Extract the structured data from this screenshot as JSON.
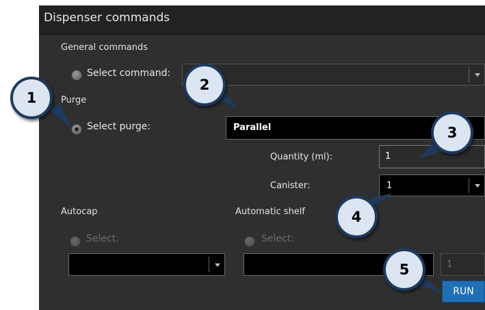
{
  "dialog": {
    "title": "Dispenser commands"
  },
  "general_commands": {
    "section_label": "General commands",
    "radio_label": "Select command:",
    "combo_value": ""
  },
  "purge": {
    "section_label": "Purge",
    "radio_label": "Select purge:",
    "combo_value": "Parallel",
    "quantity_label": "Quantity (ml):",
    "quantity_value": "1",
    "canister_label": "Canister:",
    "canister_value": "1"
  },
  "autocap": {
    "section_label": "Autocap",
    "radio_label": "Select:",
    "combo_value": ""
  },
  "automatic_shelf": {
    "section_label": "Automatic shelf",
    "radio_label": "Select:",
    "combo_value": "",
    "quantity_value": "1"
  },
  "run_button": {
    "label": "RUN"
  },
  "callouts": [
    "1",
    "2",
    "3",
    "4",
    "5"
  ],
  "colors": {
    "panel_bg": "#2f2f2f",
    "titlebar_bg": "#222222",
    "run_button": "#1e6fb6",
    "callout_fill": "#dce6f2",
    "callout_border": "#1f3a5f"
  }
}
